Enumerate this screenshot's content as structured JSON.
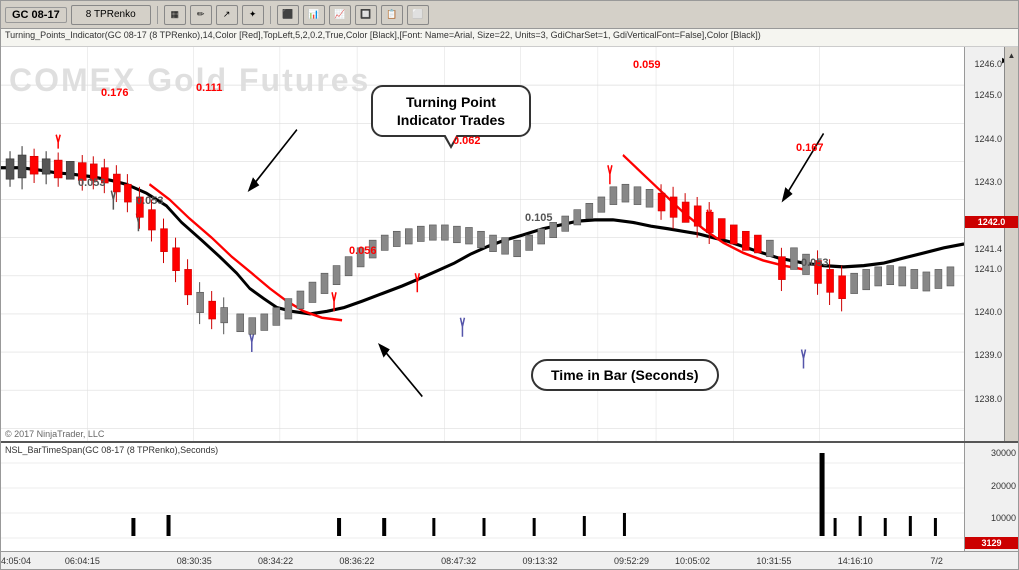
{
  "toolbar": {
    "symbol_label": "GC 08-17",
    "chart_type": "8 TPRenko",
    "nav_label": "⏭"
  },
  "indicator_bar": {
    "text": "Turning_Points_Indicator(GC 08-17 (8 TPRenko),14,Color [Red],TopLeft,5,2,0.2,True,Color [Black],[Font: Name=Arial, Size=22, Units=3, GdiCharSet=1, GdiVerticalFont=False],Color [Black])"
  },
  "chart": {
    "title": "COMEX Gold Futures",
    "bubble_text": "Turning Point\nIndicator Trades",
    "time_label_text": "Time in Bar (Seconds)",
    "price_labels": [
      {
        "value": "1246.0",
        "top_pct": 3
      },
      {
        "value": "1245.0",
        "top_pct": 11
      },
      {
        "value": "1244.0",
        "top_pct": 22
      },
      {
        "value": "1243.0",
        "top_pct": 33
      },
      {
        "value": "1242.0",
        "top_pct": 43,
        "highlighted": true
      },
      {
        "value": "1241.4",
        "top_pct": 50
      },
      {
        "value": "1241.0",
        "top_pct": 55
      },
      {
        "value": "1240.0",
        "top_pct": 66
      },
      {
        "value": "1239.0",
        "top_pct": 77
      },
      {
        "value": "1238.0",
        "top_pct": 88
      }
    ],
    "trade_labels": [
      {
        "text": "0.176",
        "color": "red",
        "left_pct": 11,
        "top_pct": 14
      },
      {
        "text": "0.111",
        "color": "red",
        "left_pct": 21,
        "top_pct": 13
      },
      {
        "text": "0.053",
        "color": "#555",
        "left_pct": 9,
        "top_pct": 45
      },
      {
        "text": "0.053",
        "color": "#555",
        "left_pct": 15,
        "top_pct": 50
      },
      {
        "text": "0.056",
        "color": "red",
        "left_pct": 37,
        "top_pct": 70
      },
      {
        "text": "0.062",
        "color": "red",
        "left_pct": 48,
        "top_pct": 30
      },
      {
        "text": "0.105",
        "color": "#555",
        "left_pct": 55,
        "top_pct": 55
      },
      {
        "text": "0.059",
        "color": "red",
        "left_pct": 66,
        "top_pct": 5
      },
      {
        "text": "0.167",
        "color": "red",
        "left_pct": 83,
        "top_pct": 32
      },
      {
        "text": "0.053",
        "color": "#555",
        "left_pct": 84,
        "top_pct": 72
      }
    ],
    "time_labels": [
      {
        "text": "4:05:04",
        "left_pct": 0
      },
      {
        "text": "06:04:15",
        "left_pct": 9
      },
      {
        "text": "08:30:35",
        "left_pct": 20
      },
      {
        "text": "08:34:22",
        "left_pct": 29
      },
      {
        "text": "08:36:22",
        "left_pct": 37
      },
      {
        "text": "08:47:32",
        "left_pct": 46
      },
      {
        "text": "09:13:32",
        "left_pct": 54
      },
      {
        "text": "09:52:29",
        "left_pct": 62
      },
      {
        "text": "10:05:02",
        "left_pct": 68
      },
      {
        "text": "10:31:55",
        "left_pct": 76
      },
      {
        "text": "14:16:10",
        "left_pct": 85
      },
      {
        "text": "7/2",
        "left_pct": 93
      }
    ]
  },
  "bottom_panel": {
    "indicator_label": "NSL_BarTimeSpan(GC 08-17 (8 TPRenko),Seconds)",
    "price_labels": [
      {
        "value": "30000",
        "top_pct": 5
      },
      {
        "value": "20000",
        "top_pct": 35
      },
      {
        "value": "10000",
        "top_pct": 65
      },
      {
        "value": "3129",
        "top_pct": 88,
        "highlighted": true
      }
    ]
  },
  "copyright": "© 2017 NinjaTrader, LLC"
}
